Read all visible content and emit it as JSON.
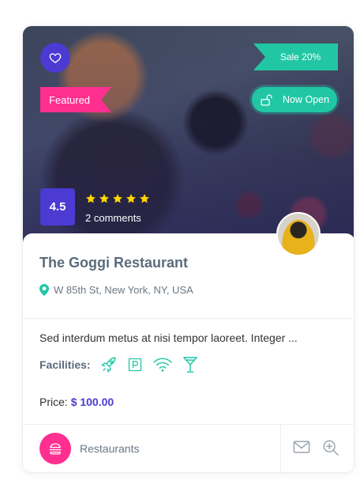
{
  "listing": {
    "sale_badge": "Sale 20%",
    "featured_badge": "Featured",
    "status_label": "Now Open",
    "rating": "4.5",
    "star_count": 5,
    "comments": "2 comments",
    "title": "The Goggi Restaurant",
    "address": "W 85th St, New York, NY, USA",
    "description": "Sed interdum metus at nisi tempor laoreet. Integer ...",
    "facilities_label": "Facilities:",
    "facility_icons": [
      "rocket-icon",
      "parking-icon",
      "wifi-icon",
      "cocktail-icon"
    ],
    "price_label": "Price:",
    "price_value": "$ 100.00",
    "category": "Restaurants"
  },
  "colors": {
    "primary": "#4b3bd2",
    "accent_green": "#21c7a5",
    "accent_pink": "#ff2f8f",
    "star": "#ffd700"
  }
}
